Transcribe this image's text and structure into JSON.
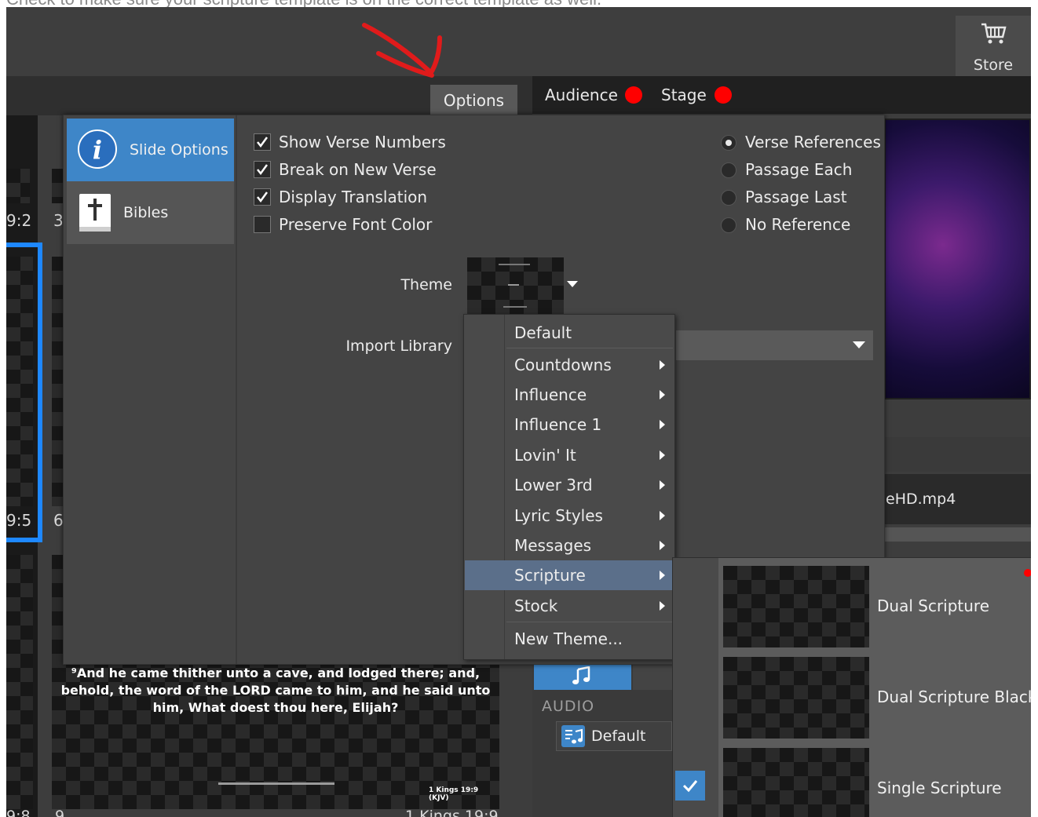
{
  "caption": "Check to make sure your scripture template is on the correct template as well.",
  "store": {
    "label": "Store",
    "icon": "cart-icon"
  },
  "tabs": {
    "options": "Options",
    "audience": "Audience",
    "stage": "Stage"
  },
  "slide_numbers": [
    "9:2",
    "3",
    "9:5",
    "6",
    "9:8",
    "9"
  ],
  "sidebar": {
    "items": [
      {
        "label": "Slide Options",
        "icon": "info-icon",
        "active": true
      },
      {
        "label": "Bibles",
        "icon": "bible-icon",
        "active": false
      }
    ]
  },
  "options": {
    "checks": [
      {
        "label": "Show Verse Numbers",
        "checked": true
      },
      {
        "label": "Break on New Verse",
        "checked": true
      },
      {
        "label": "Display Translation",
        "checked": true
      },
      {
        "label": "Preserve Font Color",
        "checked": false
      }
    ],
    "references": [
      {
        "label": "Verse References",
        "selected": true
      },
      {
        "label": "Passage Each",
        "selected": false
      },
      {
        "label": "Passage Last",
        "selected": false
      },
      {
        "label": "No Reference",
        "selected": false
      }
    ],
    "theme_label": "Theme",
    "import_label": "Import Library"
  },
  "theme_menu": {
    "items": [
      {
        "label": "Default",
        "submenu": false
      },
      {
        "label": "Countdowns",
        "submenu": true
      },
      {
        "label": "Influence",
        "submenu": true
      },
      {
        "label": "Influence 1",
        "submenu": true
      },
      {
        "label": "Lovin' It",
        "submenu": true
      },
      {
        "label": "Lower 3rd",
        "submenu": true
      },
      {
        "label": "Lyric Styles",
        "submenu": true
      },
      {
        "label": "Messages",
        "submenu": true
      },
      {
        "label": "Scripture",
        "submenu": true,
        "highlighted": true
      },
      {
        "label": "Stock",
        "submenu": true
      },
      {
        "label": "New Theme...",
        "submenu": false
      }
    ]
  },
  "scripture_submenu": {
    "items": [
      {
        "label": "Dual Scripture",
        "checked": false
      },
      {
        "label": "Dual Scripture Black T",
        "checked": false
      },
      {
        "label": "Single Scripture",
        "checked": true
      }
    ]
  },
  "media": {
    "filename": "eHD.mp4"
  },
  "audio": {
    "title": "AUDIO",
    "default_label": "Default"
  },
  "slide_preview": {
    "text": "⁹And he came thither unto a cave, and lodged there; and, behold, the word of the LORD came to him, and he said unto him, What doest thou here, Elijah?",
    "reference": "1 Kings 19:9 (KJV)",
    "bottom_label": "1 Kings 19:9"
  },
  "colors": {
    "accent": "#3e86c8",
    "live_dot": "#ff0000",
    "panel": "#444444"
  }
}
